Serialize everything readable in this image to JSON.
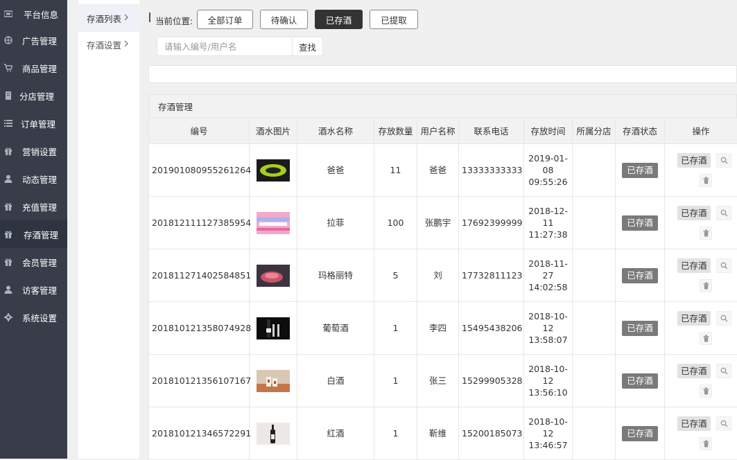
{
  "sidebar": {
    "items": [
      {
        "label": "平台信息",
        "icon": "panel-icon"
      },
      {
        "label": "广告管理",
        "icon": "globe-icon"
      },
      {
        "label": "商品管理",
        "icon": "cart-icon"
      },
      {
        "label": "分店管理",
        "icon": "building-icon"
      },
      {
        "label": "订单管理",
        "icon": "list-icon"
      },
      {
        "label": "营销设置",
        "icon": "gift-icon"
      },
      {
        "label": "动态管理",
        "icon": "user-icon"
      },
      {
        "label": "充值管理",
        "icon": "gift-icon"
      },
      {
        "label": "存酒管理",
        "icon": "gift-icon",
        "active": true
      },
      {
        "label": "会员管理",
        "icon": "gift-icon"
      },
      {
        "label": "访客管理",
        "icon": "user-icon"
      },
      {
        "label": "系统设置",
        "icon": "gear-icon"
      }
    ]
  },
  "submenu": {
    "items": [
      {
        "label": "存酒列表",
        "active": true
      },
      {
        "label": "存酒设置"
      }
    ]
  },
  "filter": {
    "location_label": "当前位置:",
    "tabs": [
      "全部订单",
      "待确认",
      "已存酒",
      "已提取"
    ],
    "active_tab": "已存酒"
  },
  "search": {
    "placeholder": "请输入编号/用户名",
    "button_label": "查找"
  },
  "panel": {
    "title": "存酒管理"
  },
  "table": {
    "columns": [
      "编号",
      "酒水图片",
      "酒水名称",
      "存放数量",
      "用户名称",
      "联系电话",
      "存放时间",
      "所属分店",
      "存酒状态",
      "操作"
    ],
    "rows": [
      {
        "id": "201901080955261264",
        "name": "爸爸",
        "qty": "11",
        "user": "爸爸",
        "phone": "13333333333",
        "time1": "2019-01-",
        "time2": "08",
        "time3": "09:55:26",
        "branch": "",
        "status": "已存酒",
        "op": "已存酒"
      },
      {
        "id": "201812111127385954",
        "name": "拉菲",
        "qty": "100",
        "user": "张鹏宇",
        "phone": "17692399999",
        "time1": "2018-12-",
        "time2": "11",
        "time3": "11:27:38",
        "branch": "",
        "status": "已存酒",
        "op": "已存酒"
      },
      {
        "id": "201811271402584851",
        "name": "玛格丽特",
        "qty": "5",
        "user": "刘",
        "phone": "17732811123",
        "time1": "2018-11-",
        "time2": "27",
        "time3": "14:02:58",
        "branch": "",
        "status": "已存酒",
        "op": "已存酒"
      },
      {
        "id": "201810121358074928",
        "name": "葡萄酒",
        "qty": "1",
        "user": "李四",
        "phone": "15495438206",
        "time1": "2018-10-",
        "time2": "12",
        "time3": "13:58:07",
        "branch": "",
        "status": "已存酒",
        "op": "已存酒"
      },
      {
        "id": "201810121356107167",
        "name": "白酒",
        "qty": "1",
        "user": "张三",
        "phone": "15299905328",
        "time1": "2018-10-",
        "time2": "12",
        "time3": "13:56:10",
        "branch": "",
        "status": "已存酒",
        "op": "已存酒"
      },
      {
        "id": "201810121346572291",
        "name": "红酒",
        "qty": "1",
        "user": "靳维",
        "phone": "15200185073",
        "time1": "2018-10-",
        "time2": "12",
        "time3": "13:46:57",
        "branch": "",
        "status": "已存酒",
        "op": "已存酒"
      }
    ]
  }
}
